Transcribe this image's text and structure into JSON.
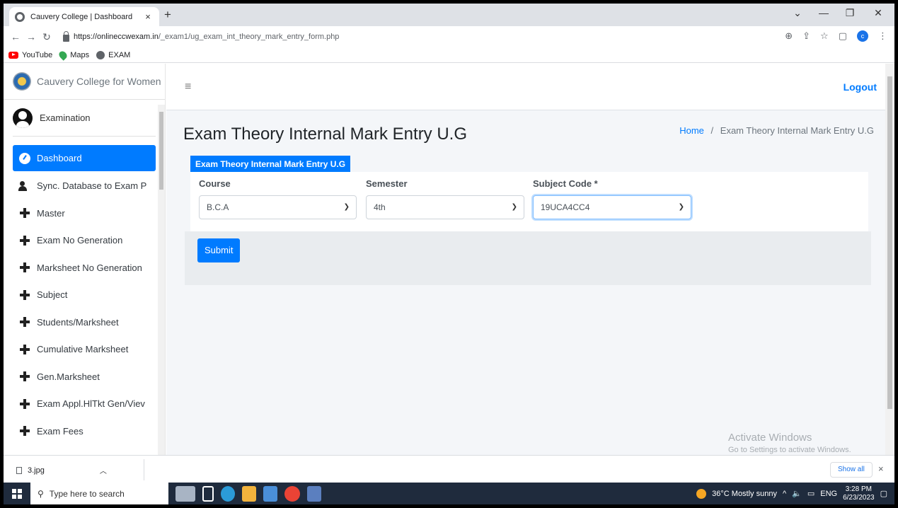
{
  "browser": {
    "tab_title": "Cauvery College | Dashboard",
    "tab_close": "×",
    "new_tab": "+",
    "url_host": "https://onlineccwexam.in",
    "url_path": "/_exam1/ug_exam_int_theory_mark_entry_form.php",
    "bookmarks": [
      "YouTube",
      "Maps",
      "EXAM"
    ],
    "profile_initial": "c"
  },
  "sidebar": {
    "brand": "Cauvery College for Women",
    "user": "Examination",
    "items": [
      {
        "label": "Dashboard",
        "icon": "dashboard-gauge-icon",
        "active": true
      },
      {
        "label": "Sync. Database to Exam P",
        "icon": "users-icon"
      },
      {
        "label": "Master",
        "icon": "plus-icon"
      },
      {
        "label": "Exam No Generation",
        "icon": "plus-icon"
      },
      {
        "label": "Marksheet No Generation",
        "icon": "plus-icon"
      },
      {
        "label": "Subject",
        "icon": "plus-icon"
      },
      {
        "label": "Students/Marksheet",
        "icon": "plus-icon"
      },
      {
        "label": "Cumulative Marksheet",
        "icon": "plus-icon"
      },
      {
        "label": "Gen.Marksheet",
        "icon": "plus-icon"
      },
      {
        "label": "Exam Appl.HlTkt Gen/Viev",
        "icon": "plus-icon"
      },
      {
        "label": "Exam Fees",
        "icon": "plus-icon"
      }
    ]
  },
  "topnav": {
    "menu_icon": "≡",
    "logout": "Logout"
  },
  "page": {
    "title": "Exam Theory Internal Mark Entry U.G",
    "breadcrumb_home": "Home",
    "breadcrumb_sep": "/",
    "breadcrumb_current": "Exam Theory Internal Mark Entry U.G"
  },
  "form": {
    "card_title": "Exam Theory Internal Mark Entry U.G",
    "course": {
      "label": "Course",
      "value": "B.C.A"
    },
    "semester": {
      "label": "Semester",
      "value": "4th"
    },
    "subject": {
      "label": "Subject Code *",
      "value": "19UCA4CC4"
    },
    "submit": "Submit"
  },
  "watermark": {
    "line1": "Activate Windows",
    "line2": "Go to Settings to activate Windows."
  },
  "downloads": {
    "file": "3.jpg",
    "show_all": "Show all",
    "close": "×"
  },
  "taskbar": {
    "search_placeholder": "Type here to search",
    "weather": "36°C  Mostly sunny",
    "lang": "ENG",
    "time": "3:28 PM",
    "date": "6/23/2023"
  },
  "colors": {
    "accent": "#007bff",
    "panel": "#e9ecef",
    "taskbar": "#1f2b3d"
  }
}
